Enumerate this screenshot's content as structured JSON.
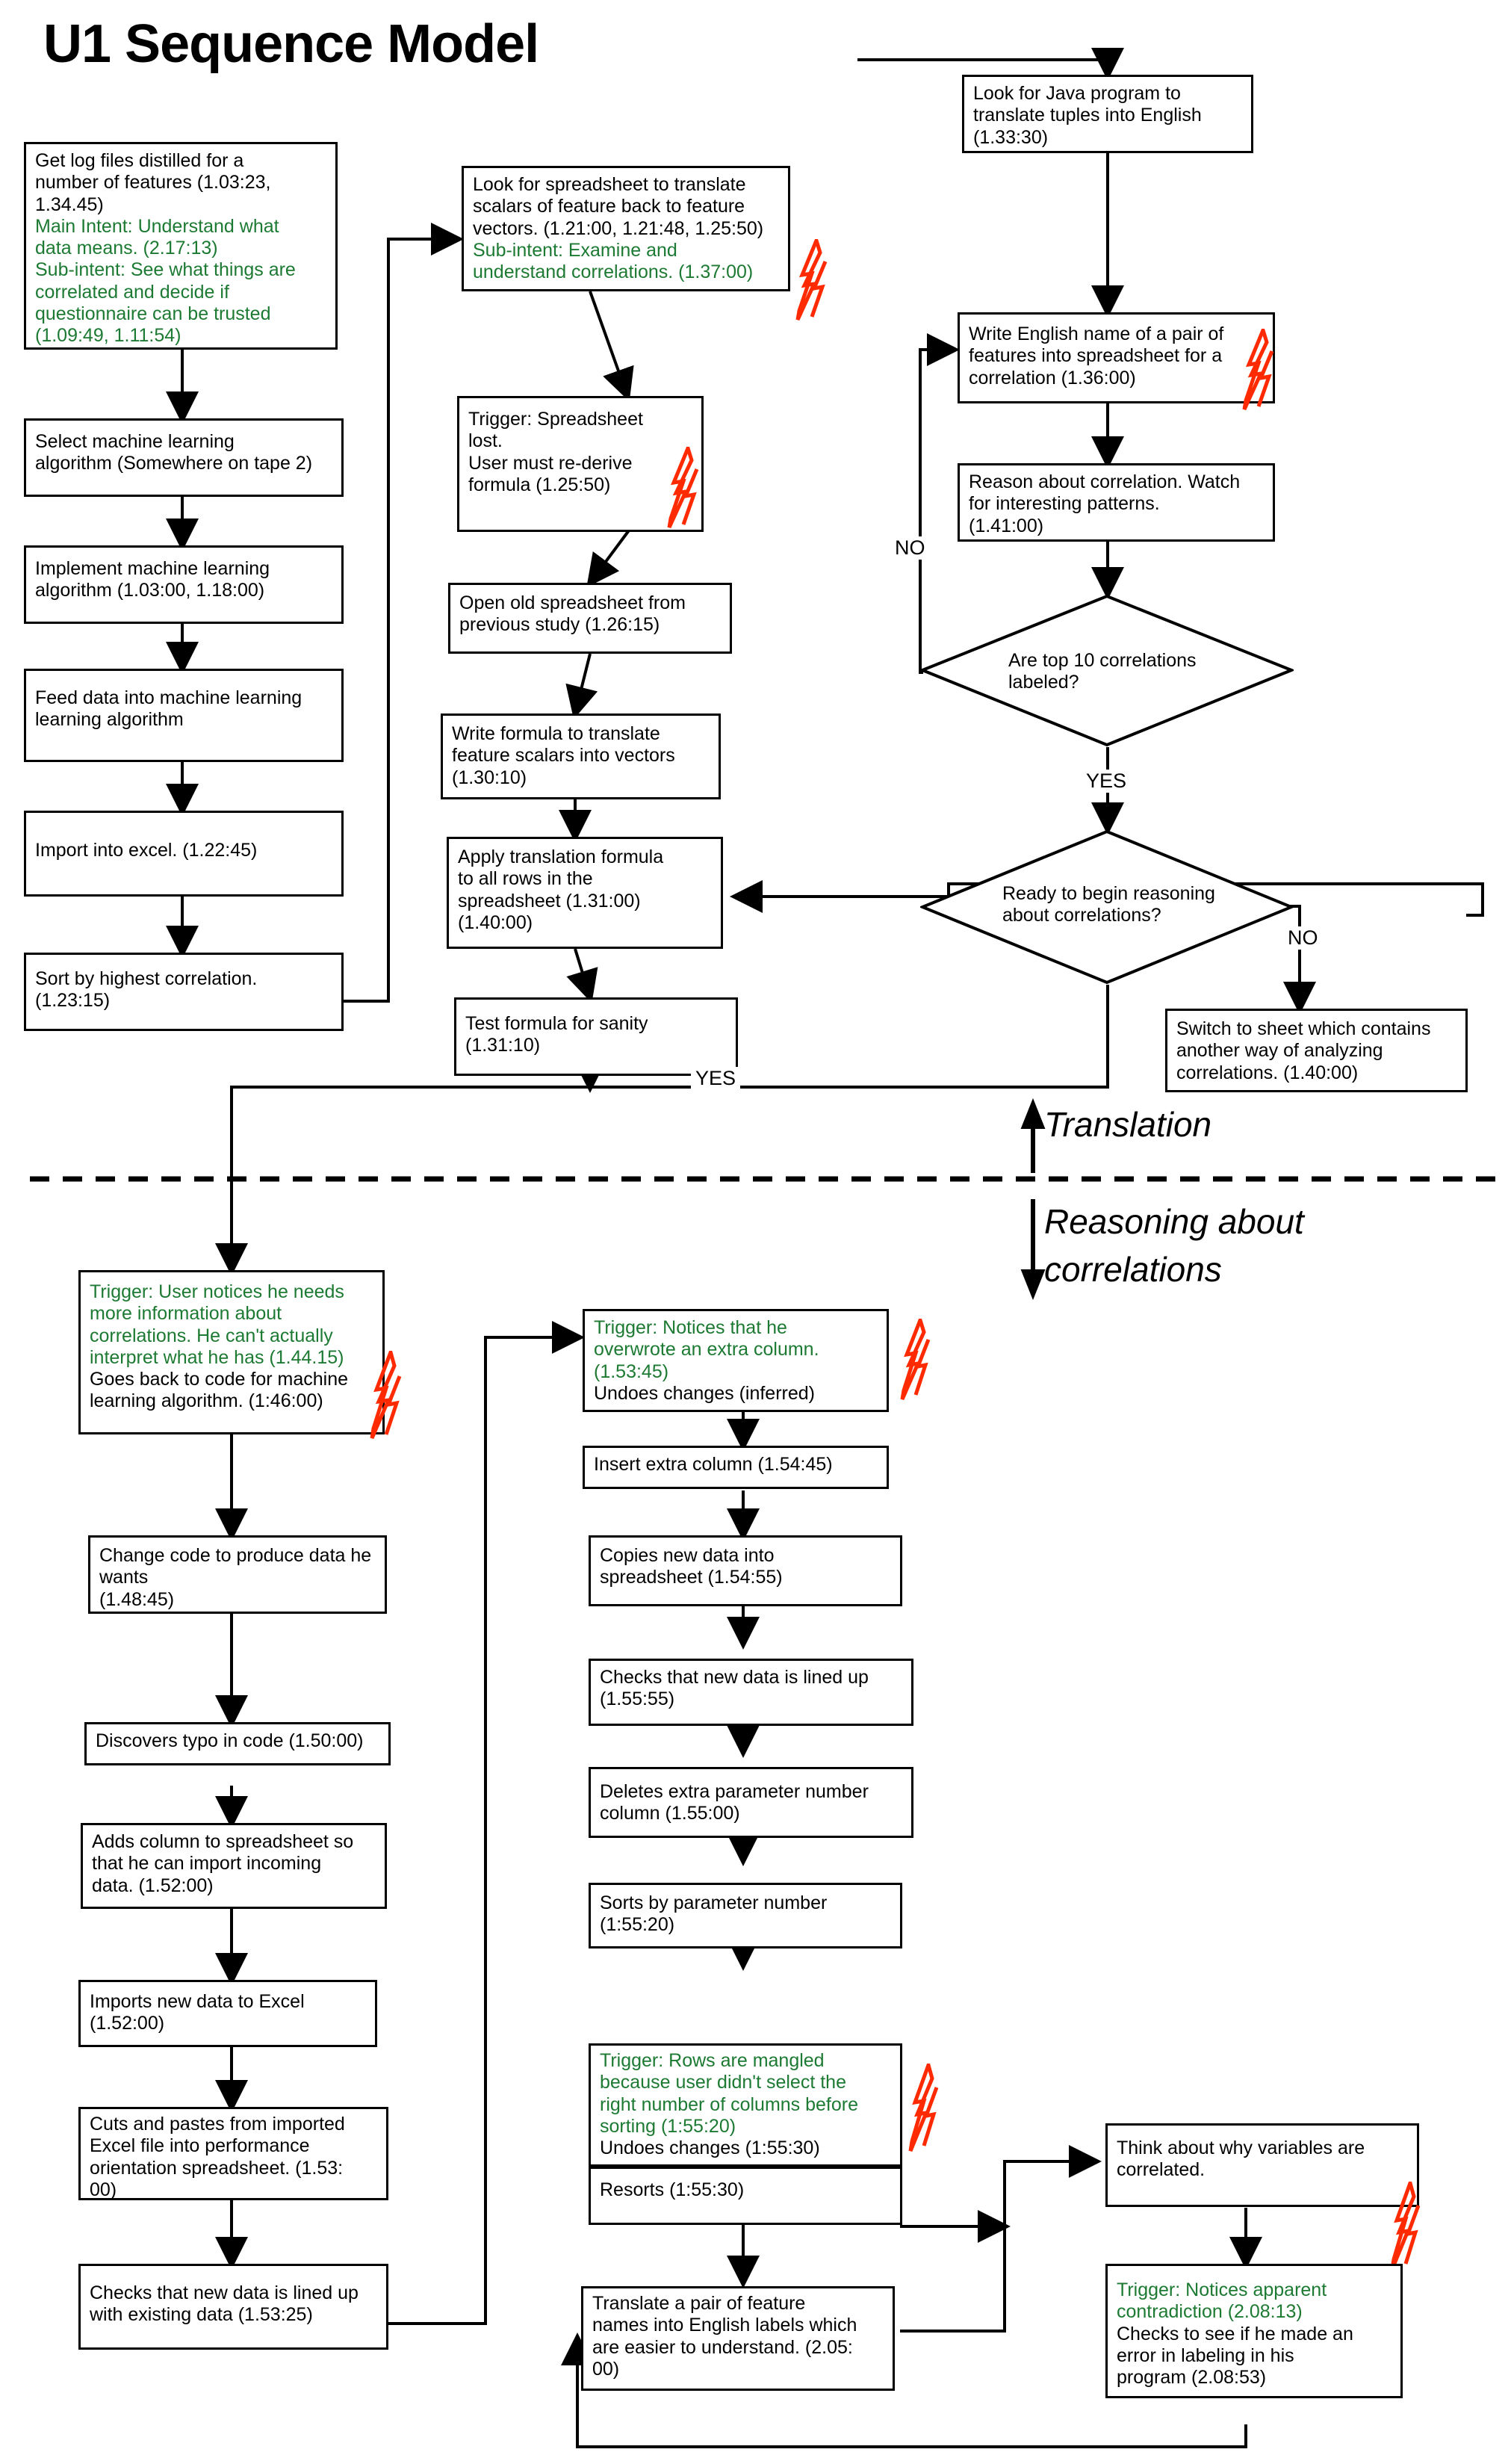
{
  "title": "U1 Sequence Model",
  "colors": {
    "trigger_green": "#1d7a33",
    "bolt_red": "#ff2a00",
    "line_black": "#000000"
  },
  "section_labels": {
    "above": "Translation",
    "below_line1": "Reasoning about",
    "below_line2": "correlations"
  },
  "edge_labels": {
    "no_1": "NO",
    "yes_1": "YES",
    "no_2": "NO",
    "yes_2": "YES"
  },
  "nodes": {
    "get_log_files": {
      "lines": [
        {
          "text": "Get log files distilled for a",
          "color": "black"
        },
        {
          "text": "number of features (1.03:23,",
          "color": "black"
        },
        {
          "text": "1.34.45)",
          "color": "black"
        },
        {
          "text": "Main Intent: Understand what",
          "color": "green"
        },
        {
          "text": "data means. (2.17:13)",
          "color": "green"
        },
        {
          "text": "Sub-intent: See what things are",
          "color": "green"
        },
        {
          "text": "correlated and decide if",
          "color": "green"
        },
        {
          "text": "questionnaire can be trusted",
          "color": "green"
        },
        {
          "text": "(1.09:49, 1.11:54)",
          "color": "green"
        }
      ]
    },
    "select_ml": {
      "lines": [
        {
          "text": "Select machine learning",
          "color": "black"
        },
        {
          "text": "algorithm (Somewhere on tape 2)",
          "color": "black"
        }
      ]
    },
    "implement_ml": {
      "lines": [
        {
          "text": "Implement machine learning",
          "color": "black"
        },
        {
          "text": "algorithm (1.03:00, 1.18:00)",
          "color": "black"
        }
      ]
    },
    "feed_data": {
      "lines": [
        {
          "text": "Feed data into machine learning",
          "color": "black"
        },
        {
          "text": "learning algorithm",
          "color": "black"
        }
      ]
    },
    "import_excel": {
      "lines": [
        {
          "text": "Import into excel. (1.22:45)",
          "color": "black"
        }
      ]
    },
    "sort_highest": {
      "lines": [
        {
          "text": "Sort by highest correlation.",
          "color": "black"
        },
        {
          "text": "(1.23:15)",
          "color": "black"
        }
      ]
    },
    "look_spreadsheet": {
      "lines": [
        {
          "text": "Look for spreadsheet to translate",
          "color": "black"
        },
        {
          "text": "scalars of feature back to feature",
          "color": "black"
        },
        {
          "text": "vectors. (1.21:00, 1.21:48, 1.25:50)",
          "color": "black"
        },
        {
          "text": "Sub-intent: Examine and",
          "color": "green"
        },
        {
          "text": "understand correlations. (1.37:00)",
          "color": "green"
        }
      ],
      "has_bolt": true
    },
    "trigger_spreadsheet_lost": {
      "lines": [
        {
          "text": "Trigger: Spreadsheet",
          "color": "black"
        },
        {
          "text": "lost.",
          "color": "black"
        },
        {
          "text": "User must re-derive",
          "color": "black"
        },
        {
          "text": "formula (1.25:50)",
          "color": "black"
        }
      ],
      "has_bolt": true
    },
    "open_old_spreadsheet": {
      "lines": [
        {
          "text": "Open old spreadsheet from",
          "color": "black"
        },
        {
          "text": "previous study (1.26:15)",
          "color": "black"
        }
      ]
    },
    "write_formula": {
      "lines": [
        {
          "text": "Write formula to translate",
          "color": "black"
        },
        {
          "text": "feature scalars into vectors",
          "color": "black"
        },
        {
          "text": "(1.30:10)",
          "color": "black"
        }
      ]
    },
    "apply_translation": {
      "lines": [
        {
          "text": "Apply translation formula",
          "color": "black"
        },
        {
          "text": "to all rows in the",
          "color": "black"
        },
        {
          "text": "spreadsheet (1.31:00)",
          "color": "black"
        },
        {
          "text": "(1.40:00)",
          "color": "black"
        }
      ]
    },
    "test_formula": {
      "lines": [
        {
          "text": "Test formula for sanity",
          "color": "black"
        },
        {
          "text": "(1.31:10)",
          "color": "black"
        }
      ]
    },
    "look_java": {
      "lines": [
        {
          "text": "Look for Java program to",
          "color": "black"
        },
        {
          "text": "translate tuples into English",
          "color": "black"
        },
        {
          "text": "(1.33:30)",
          "color": "black"
        }
      ]
    },
    "write_english_name": {
      "lines": [
        {
          "text": "Write English name of a pair of",
          "color": "black"
        },
        {
          "text": "features into spreadsheet for a",
          "color": "black"
        },
        {
          "text": "correlation (1.36:00)",
          "color": "black"
        }
      ],
      "has_bolt": true
    },
    "reason_correlation": {
      "lines": [
        {
          "text": "Reason about correlation. Watch",
          "color": "black"
        },
        {
          "text": "for interesting patterns.",
          "color": "black"
        },
        {
          "text": "(1.41:00)",
          "color": "black"
        }
      ]
    },
    "are_top10": {
      "lines": [
        {
          "text": "Are top 10 correlations",
          "color": "black"
        },
        {
          "text": "labeled?",
          "color": "black"
        }
      ]
    },
    "ready_reasoning": {
      "lines": [
        {
          "text": "Ready to begin reasoning",
          "color": "black"
        },
        {
          "text": "about correlations?",
          "color": "black"
        }
      ]
    },
    "switch_sheet": {
      "lines": [
        {
          "text": "Switch to sheet which contains",
          "color": "black"
        },
        {
          "text": "another way of analyzing",
          "color": "black"
        },
        {
          "text": "correlations.  (1.40:00)",
          "color": "black"
        }
      ]
    },
    "trigger_more_info": {
      "lines": [
        {
          "text": "Trigger: User notices he needs",
          "color": "green"
        },
        {
          "text": "more information about",
          "color": "green"
        },
        {
          "text": "correlations. He can't actually",
          "color": "green"
        },
        {
          "text": "interpret what he has (1.44.15)",
          "color": "green"
        },
        {
          "text": "Goes back to code for machine",
          "color": "black"
        },
        {
          "text": "learning algorithm. (1:46:00)",
          "color": "black"
        }
      ],
      "has_bolt": true
    },
    "change_code": {
      "lines": [
        {
          "text": "Change code to produce data he",
          "color": "black"
        },
        {
          "text": "wants",
          "color": "black"
        },
        {
          "text": "(1.48:45)",
          "color": "black"
        }
      ]
    },
    "discovers_typo": {
      "lines": [
        {
          "text": "Discovers typo in code  (1.50:00)",
          "color": "black"
        }
      ]
    },
    "adds_column": {
      "lines": [
        {
          "text": "Adds column to spreadsheet so",
          "color": "black"
        },
        {
          "text": "that he can import incoming",
          "color": "black"
        },
        {
          "text": "data.  (1.52:00)",
          "color": "black"
        }
      ]
    },
    "imports_new_data": {
      "lines": [
        {
          "text": "Imports new data to Excel",
          "color": "black"
        },
        {
          "text": "(1.52:00)",
          "color": "black"
        }
      ]
    },
    "cuts_pastes": {
      "lines": [
        {
          "text": "Cuts and pastes from imported",
          "color": "black"
        },
        {
          "text": "Excel file into performance",
          "color": "black"
        },
        {
          "text": "orientation spreadsheet. (1.53:",
          "color": "black"
        },
        {
          "text": "00)",
          "color": "black"
        }
      ]
    },
    "checks_lined_up_left": {
      "lines": [
        {
          "text": "Checks that new data is lined up",
          "color": "black"
        },
        {
          "text": "with existing data (1.53:25)",
          "color": "black"
        }
      ]
    },
    "trigger_overwrote": {
      "lines": [
        {
          "text": "Trigger: Notices that he",
          "color": "green"
        },
        {
          "text": "overwrote an extra column.",
          "color": "green"
        },
        {
          "text": "(1.53:45)",
          "color": "green"
        },
        {
          "text": "Undoes changes (inferred)",
          "color": "black"
        }
      ],
      "has_bolt": true
    },
    "insert_extra_column": {
      "lines": [
        {
          "text": "Insert extra column (1.54:45)",
          "color": "black"
        }
      ]
    },
    "copies_new_data": {
      "lines": [
        {
          "text": "Copies new data into",
          "color": "black"
        },
        {
          "text": "spreadsheet (1.54:55)",
          "color": "black"
        }
      ]
    },
    "checks_lined_up_mid": {
      "lines": [
        {
          "text": "Checks that new data is lined up",
          "color": "black"
        },
        {
          "text": "(1.55:55)",
          "color": "black"
        }
      ]
    },
    "deletes_extra_param": {
      "lines": [
        {
          "text": "Deletes extra parameter number",
          "color": "black"
        },
        {
          "text": "column (1.55:00)",
          "color": "black"
        }
      ]
    },
    "sorts_by_param": {
      "lines": [
        {
          "text": "Sorts by parameter number",
          "color": "black"
        },
        {
          "text": "(1:55:20)",
          "color": "black"
        }
      ]
    },
    "trigger_rows_mangled": {
      "lines": [
        {
          "text": "Trigger: Rows are mangled",
          "color": "green"
        },
        {
          "text": "because user didn't select the",
          "color": "green"
        },
        {
          "text": "right number of columns before",
          "color": "green"
        },
        {
          "text": "sorting  (1:55:20)",
          "color": "green"
        },
        {
          "text": "Undoes changes (1:55:30)",
          "color": "black"
        }
      ],
      "has_bolt": true
    },
    "resorts": {
      "lines": [
        {
          "text": "Resorts (1:55:30)",
          "color": "black"
        }
      ]
    },
    "translate_pair": {
      "lines": [
        {
          "text": "Translate a pair of feature",
          "color": "black"
        },
        {
          "text": "names into English labels which",
          "color": "black"
        },
        {
          "text": "are easier to understand. (2.05:",
          "color": "black"
        },
        {
          "text": "00)",
          "color": "black"
        }
      ]
    },
    "think_about_why": {
      "lines": [
        {
          "text": "Think about why variables are",
          "color": "black"
        },
        {
          "text": "correlated.",
          "color": "black"
        }
      ]
    },
    "trigger_contradiction": {
      "lines": [
        {
          "text": "Trigger: Notices apparent",
          "color": "green"
        },
        {
          "text": "contradiction (2.08:13)",
          "color": "green"
        },
        {
          "text": "Checks to see if he made an",
          "color": "black"
        },
        {
          "text": "error in labeling in his",
          "color": "black"
        },
        {
          "text": "program (2.08:53)",
          "color": "black"
        }
      ],
      "has_bolt": true
    }
  }
}
